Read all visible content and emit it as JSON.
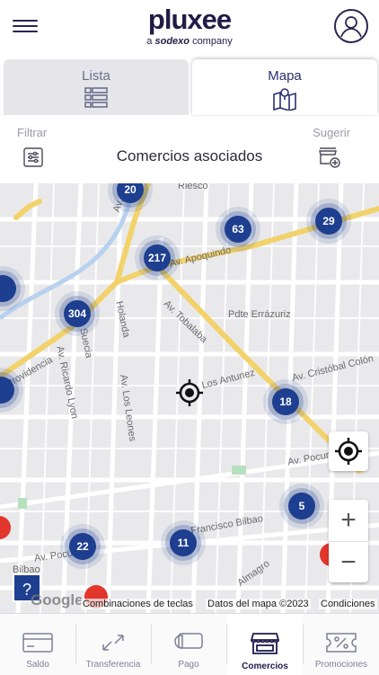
{
  "header": {
    "brand": "pluxee",
    "tagline_prefix": "a",
    "tagline_company": "sodexo",
    "tagline_suffix": "company"
  },
  "tabs": [
    {
      "label": "Lista",
      "icon": "list-icon",
      "active": false
    },
    {
      "label": "Mapa",
      "icon": "map-pin-icon",
      "active": true
    }
  ],
  "filterbar": {
    "filter_label": "Filtrar",
    "title": "Comercios asociados",
    "suggest_label": "Sugerir"
  },
  "map": {
    "streets": [
      "Av. Vitacura",
      "Av. Apoquindo",
      "Holanda",
      "Av. Tobalaba",
      "Pdte Errázuriz",
      "Av. Cristóbal Colón",
      "Los Antunez",
      "Suecia",
      "Av. Ricardo Lyon",
      "Av. Los Leones",
      "Providencia",
      "Av. Pocuro",
      "Francisco Bilbao",
      "Almagro",
      "Bilbao",
      "Riesco",
      "Av. Pocuro"
    ],
    "clusters": [
      "20",
      "63",
      "29",
      "217",
      "304",
      "18",
      "5",
      "22",
      "11"
    ],
    "attribution": {
      "shortcuts": "Combinaciones de teclas",
      "data": "Datos del mapa ©2023",
      "terms": "Condiciones",
      "google": "Google"
    },
    "help": "?",
    "zoom_in": "+",
    "zoom_out": "−"
  },
  "nav": [
    {
      "label": "Saldo",
      "icon": "card-icon"
    },
    {
      "label": "Transferencia",
      "icon": "transfer-arrows-icon"
    },
    {
      "label": "Pago",
      "icon": "payment-card-icon"
    },
    {
      "label": "Comercios",
      "icon": "store-icon",
      "active": true
    },
    {
      "label": "Promociones",
      "icon": "discount-ticket-icon"
    }
  ],
  "colors": {
    "primary": "#1e3f8f",
    "brand": "#221c46",
    "road_major": "#f2d26a",
    "marker_red": "#e2352c"
  }
}
